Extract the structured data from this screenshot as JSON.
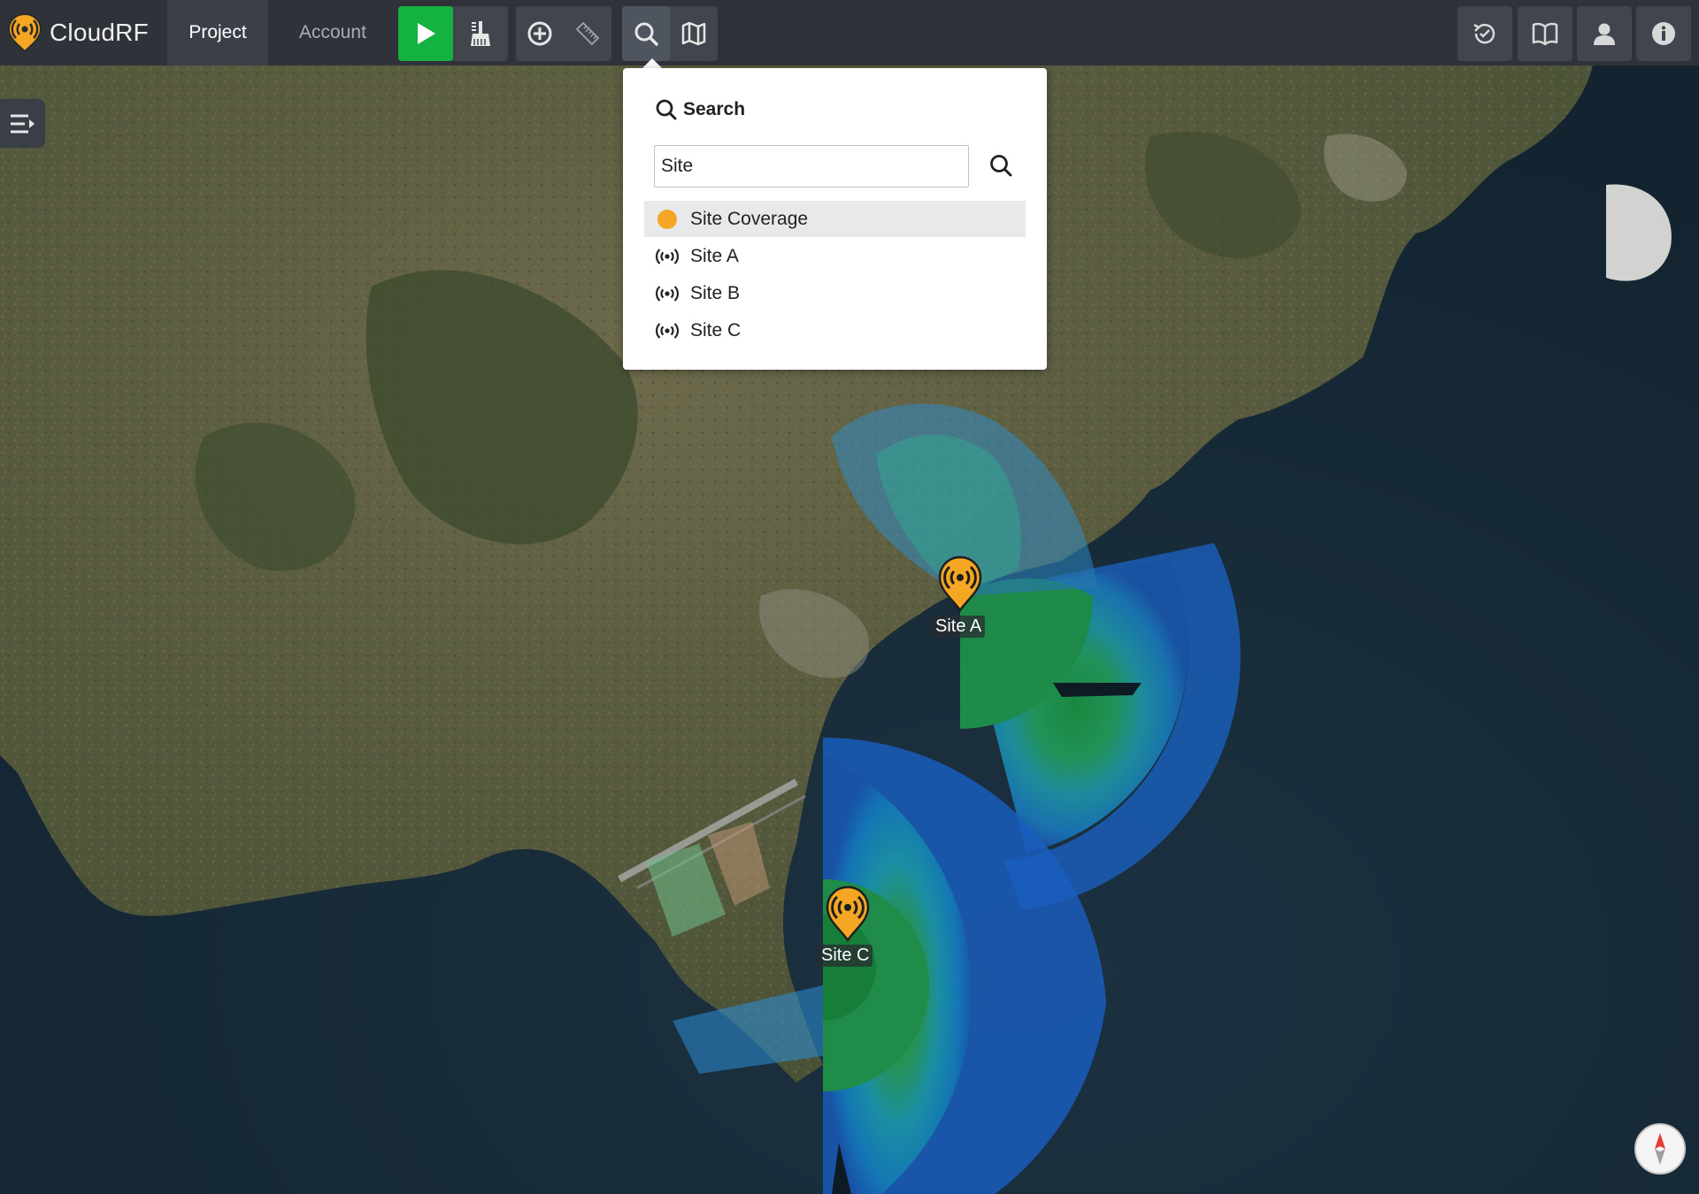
{
  "app": {
    "name": "CloudRF",
    "logo_icon": "cloudrf-logo-icon"
  },
  "nav": {
    "tabs": [
      {
        "label": "Project",
        "active": true
      },
      {
        "label": "Account",
        "active": false
      }
    ]
  },
  "toolbar": {
    "left_tools": [
      "play-icon",
      "broom-icon",
      "add-circle-icon",
      "ruler-icon",
      "search-icon",
      "map-icon"
    ],
    "right_tools": [
      "history-icon",
      "book-icon",
      "user-icon",
      "info-icon"
    ],
    "accent_color": "#14b341"
  },
  "search": {
    "title": "Search",
    "query": "Site",
    "results": [
      {
        "label": "Site Coverage",
        "icon": "orange-dot-icon",
        "selected": true
      },
      {
        "label": "Site A",
        "icon": "broadcast-icon",
        "selected": false
      },
      {
        "label": "Site B",
        "icon": "broadcast-icon",
        "selected": false
      },
      {
        "label": "Site C",
        "icon": "broadcast-icon",
        "selected": false
      }
    ]
  },
  "map": {
    "sites": [
      {
        "label": "Site A",
        "icon": "site-marker-icon"
      },
      {
        "label": "Site C",
        "icon": "site-marker-icon"
      }
    ],
    "marker_color": "#f5a623",
    "compass_icon": "compass-icon"
  }
}
